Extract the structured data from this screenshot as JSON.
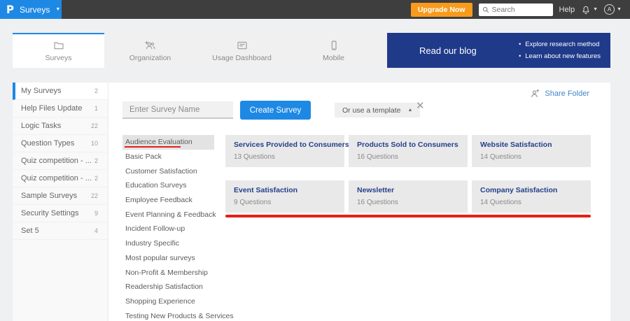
{
  "colors": {
    "accent_blue": "#1e88e5",
    "navy": "#203a8a",
    "orange": "#f89b1c",
    "annotation_red": "#e42014",
    "topbar_dark": "#3e3e3e"
  },
  "topbar": {
    "logo": "P",
    "product": "Surveys",
    "upgrade_label": "Upgrade Now",
    "search_placeholder": "Search",
    "help_label": "Help",
    "avatar_letter": "A"
  },
  "tabs": [
    {
      "label": "Surveys",
      "active": true
    },
    {
      "label": "Organization",
      "active": false
    },
    {
      "label": "Usage Dashboard",
      "active": false
    },
    {
      "label": "Mobile",
      "active": false
    }
  ],
  "blog": {
    "title": "Read our blog",
    "bullets": [
      "Explore research method",
      "Learn about new features"
    ]
  },
  "sidebar": {
    "items": [
      {
        "label": "My Surveys",
        "count": "2",
        "active": true
      },
      {
        "label": "Help Files Update",
        "count": "1",
        "active": false
      },
      {
        "label": "Logic Tasks",
        "count": "22",
        "active": false
      },
      {
        "label": "Question Types",
        "count": "10",
        "active": false
      },
      {
        "label": "Quiz competition - ...",
        "count": "2",
        "active": false
      },
      {
        "label": "Quiz competition - ...",
        "count": "2",
        "active": false
      },
      {
        "label": "Sample Surveys",
        "count": "22",
        "active": false
      },
      {
        "label": "Security Settings",
        "count": "9",
        "active": false
      },
      {
        "label": "Set 5",
        "count": "4",
        "active": false
      }
    ]
  },
  "content": {
    "share_folder_label": "Share Folder",
    "survey_name_placeholder": "Enter Survey Name",
    "create_button_label": "Create Survey",
    "template_dropdown_label": "Or use a template",
    "close_label": "✕",
    "selected_category": "Audience Evaluation",
    "categories": [
      "Audience Evaluation",
      "Basic Pack",
      "Customer Satisfaction",
      "Education Surveys",
      "Employee Feedback",
      "Event Planning & Feedback",
      "Incident Follow-up",
      "Industry Specific",
      "Most popular surveys",
      "Non-Profit & Membership",
      "Readership Satisfaction",
      "Shopping Experience",
      "Testing New Products & Services"
    ],
    "templates": [
      {
        "title": "Services Provided to Consumers",
        "questions": "13 Questions"
      },
      {
        "title": "Products Sold to Consumers",
        "questions": "16 Questions"
      },
      {
        "title": "Website Satisfaction",
        "questions": "14 Questions"
      },
      {
        "title": "Event Satisfaction",
        "questions": "9 Questions"
      },
      {
        "title": "Newsletter",
        "questions": "16 Questions"
      },
      {
        "title": "Company Satisfaction",
        "questions": "14 Questions"
      }
    ]
  }
}
